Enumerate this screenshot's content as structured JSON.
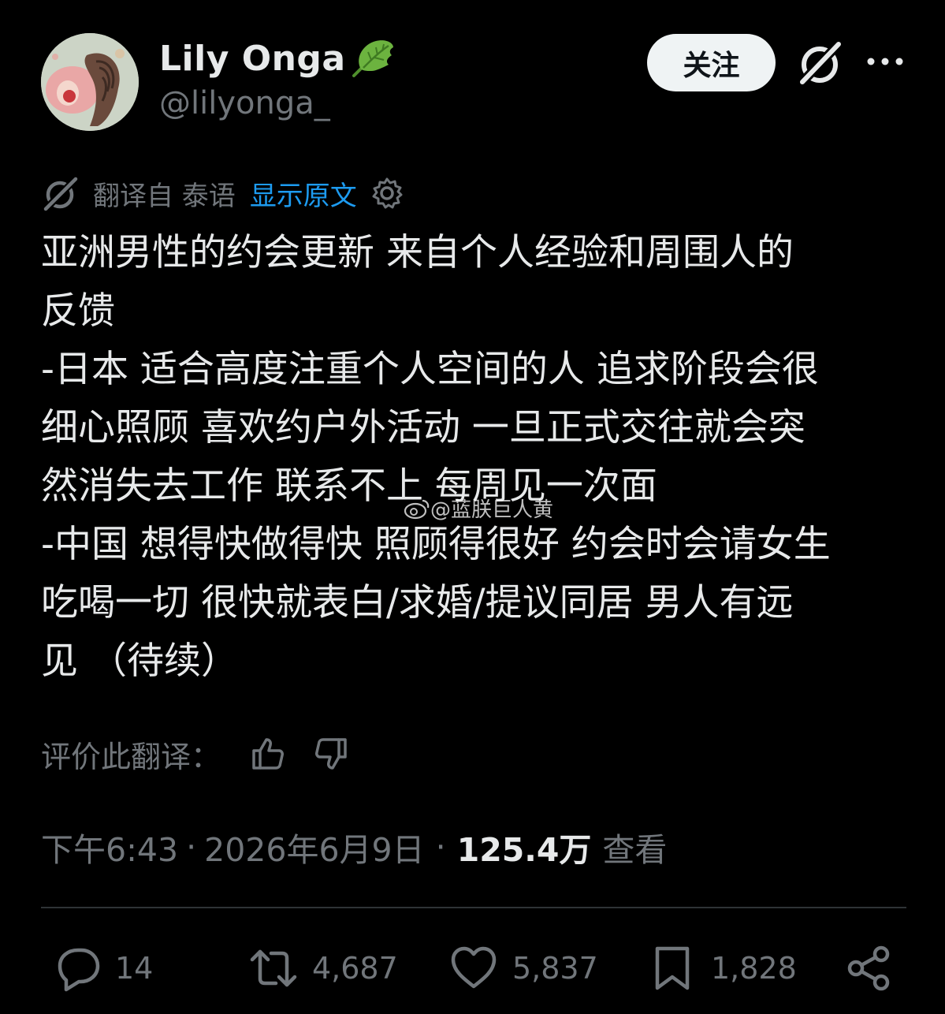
{
  "user": {
    "display_name": "Lily Onga",
    "handle": "@lilyonga_"
  },
  "header": {
    "follow_label": "关注"
  },
  "translation": {
    "translated_from": "翻译自 泰语",
    "show_original": "显示原文"
  },
  "tweet": {
    "text": "亚洲男性的约会更新 来自个人经验和周围人的\n反馈\n-日本 适合高度注重个人空间的人 追求阶段会很\n细心照顾 喜欢约户外活动 一旦正式交往就会突\n然消失去工作 联系不上 每周见一次面\n-中国 想得快做得快 照顾得很好 约会时会请女生\n吃喝一切 很快就表白/求婚/提议同居 男人有远\n见 （待续）"
  },
  "watermark": {
    "text": "@蓝朕巨人黄"
  },
  "rating": {
    "label": "评价此翻译："
  },
  "meta": {
    "time": "下午6:43",
    "separator": "·",
    "date": "2026年6月9日",
    "views_count": "125.4万",
    "views_label": "查看"
  },
  "actions": {
    "replies": "14",
    "reposts": "4,687",
    "likes": "5,837",
    "bookmarks": "1,828"
  },
  "colors": {
    "background": "#000000",
    "text": "#e7e9ea",
    "secondary": "#71767b",
    "link": "#1d9bf0",
    "leaf": "#5fa33a"
  }
}
